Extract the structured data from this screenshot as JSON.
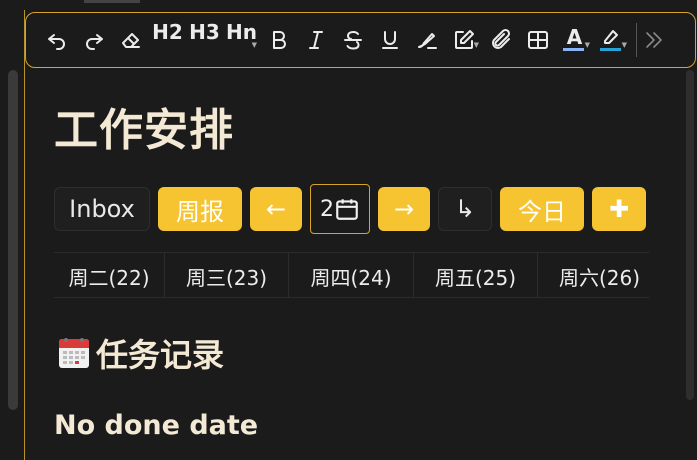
{
  "toolbar": {
    "h2": "H2",
    "h3": "H3",
    "hn": "Hn",
    "font_color_letter": "A",
    "font_color_underline": "#8ab4f8",
    "highlight_underline": "#29a3d6"
  },
  "page": {
    "title": "工作安排"
  },
  "nav": {
    "inbox": "Inbox",
    "weekly_report": "周报",
    "prev": "←",
    "date_value": "2",
    "next": "→",
    "jump": "↳",
    "today": "今日",
    "add": "✚"
  },
  "week": {
    "days": [
      "周二(22)",
      "周三(23)",
      "周四(24)",
      "周五(25)",
      "周六(26)"
    ]
  },
  "sections": {
    "task_log": "任务记录",
    "no_done_date": "No done date"
  },
  "colors": {
    "accent": "#f6c331",
    "frame": "#d6a429",
    "title": "#f4e9d5"
  }
}
